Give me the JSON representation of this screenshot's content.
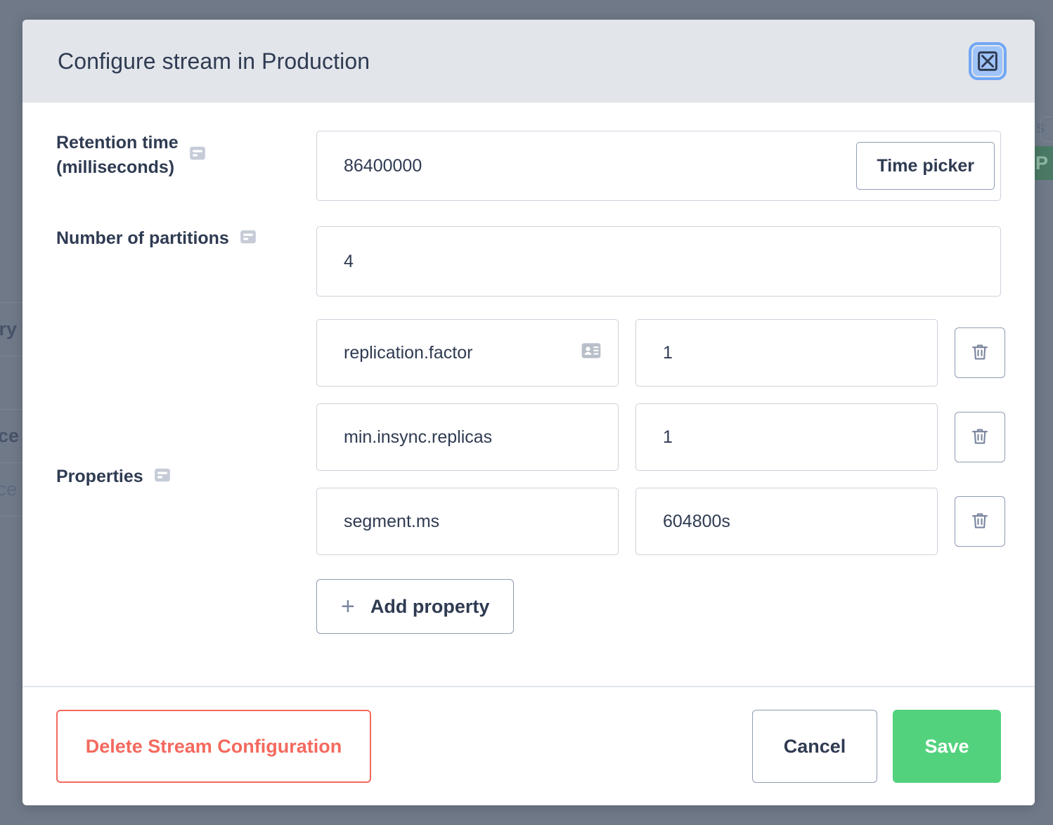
{
  "overlay": {
    "background_color": "#6f7988",
    "table_rows": [
      {
        "text": "ory",
        "style": "bold"
      },
      {
        "text": "",
        "style": "bold"
      },
      {
        "text": "cce",
        "style": "bold"
      },
      {
        "text": "cce",
        "style": "light"
      }
    ],
    "right_edge": {
      "text": "s",
      "pill_label": "P",
      "pill_color": "#4a7a65"
    }
  },
  "modal": {
    "title": "Configure stream in Production",
    "close_icon": "close-icon",
    "header_color": "#e2e5ea",
    "fields": {
      "retention": {
        "label_line1": "Retention time",
        "label_line2": "(milliseconds)",
        "icon": "form-field-icon",
        "value": "86400000",
        "time_picker_label": "Time picker"
      },
      "partitions": {
        "label": "Number of partitions",
        "icon": "form-field-icon",
        "value": "4"
      },
      "properties": {
        "label": "Properties",
        "icon": "form-field-icon",
        "add_property_label": "Add property",
        "add_property_icon": "plus-icon",
        "delete_icon": "trash-icon",
        "rows": [
          {
            "key": "replication.factor",
            "value": "1",
            "key_icon": "id-card-icon"
          },
          {
            "key": "min.insync.replicas",
            "value": "1",
            "key_icon": ""
          },
          {
            "key": "segment.ms",
            "value": "604800s",
            "key_icon": ""
          }
        ]
      }
    },
    "footer": {
      "delete_label": "Delete Stream Configuration",
      "delete_color": "#f4695e",
      "cancel_label": "Cancel",
      "save_label": "Save",
      "save_color": "#52d27d"
    }
  }
}
